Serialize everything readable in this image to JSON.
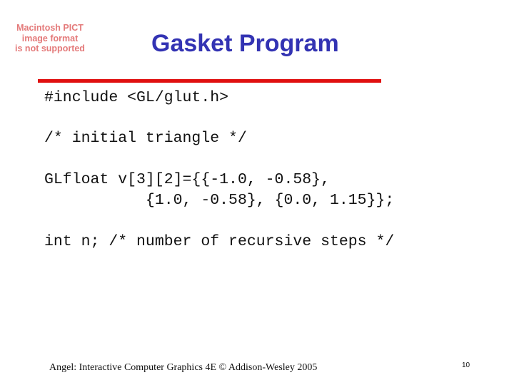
{
  "image_placeholder": {
    "lines": [
      "Macintosh PICT",
      "image format",
      "is not supported"
    ]
  },
  "slide": {
    "title": "Gasket Program",
    "code_lines": [
      "#include <GL/glut.h>",
      "/* initial triangle */",
      "GLfloat v[3][2]={{-1.0, -0.58},",
      "           {1.0, -0.58}, {0.0, 1.15}};",
      "int n; /* number of recursive steps */"
    ]
  },
  "footer": {
    "credit": "Angel: Interactive Computer Graphics 4E © Addison-Wesley 2005",
    "page_number": "10"
  },
  "colors": {
    "title": "#3333b3",
    "rule": "#e01010",
    "placeholder_text": "#e47a7a"
  }
}
